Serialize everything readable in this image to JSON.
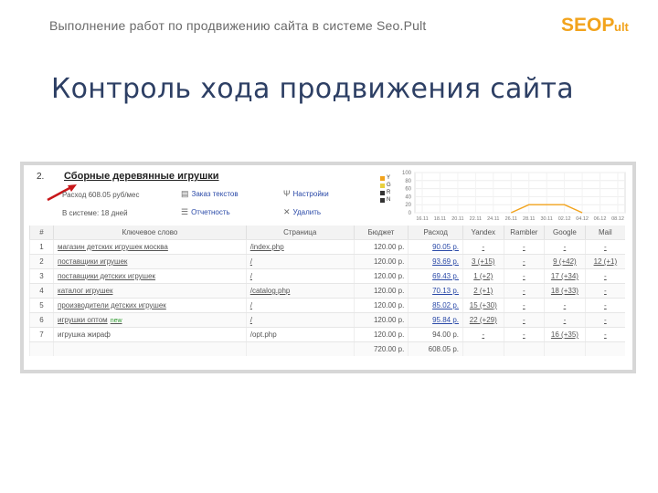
{
  "header": {
    "title": "Выполнение работ по продвижению сайта в системе Seo.Pult",
    "logo_main": "SEOP",
    "logo_small": "ult"
  },
  "slide_title": "Контроль хода продвижения сайта",
  "project": {
    "number": "2.",
    "name": "Сборные деревянные игрушки",
    "expense": "Расход 608.05 руб/мес",
    "in_system": "В системе: 18 дней",
    "actions": [
      {
        "label": "Заказ текстов",
        "icon": "document-icon"
      },
      {
        "label": "Настройки",
        "icon": "settings-icon"
      },
      {
        "label": "Отчетность",
        "icon": "report-icon"
      },
      {
        "label": "Удалить",
        "icon": "close-icon"
      }
    ]
  },
  "chart_data": {
    "type": "line",
    "y_ticks": [
      "100",
      "80",
      "60",
      "40",
      "20",
      "0"
    ],
    "x_ticks": [
      "16.11",
      "18.11",
      "20.11",
      "22.11",
      "24.11",
      "26.11",
      "28.11",
      "30.11",
      "02.12",
      "04.12",
      "06.12",
      "08.12"
    ],
    "legend": [
      {
        "label": "Y",
        "color": "#f2a31c"
      },
      {
        "label": "G",
        "color": "#e8d040"
      },
      {
        "label": "R",
        "color": "#333333"
      },
      {
        "label": "N",
        "color": "#333333"
      }
    ],
    "series": [
      {
        "color": "#f2a31c",
        "values": [
          null,
          null,
          null,
          null,
          null,
          0,
          20,
          20,
          20,
          0,
          null,
          null
        ]
      }
    ],
    "ylim": [
      0,
      100
    ],
    "grid": true
  },
  "table": {
    "headers": [
      "#",
      "Ключевое слово",
      "Страница",
      "Бюджет",
      "Расход",
      "Yandex",
      "Rambler",
      "Google",
      "Mail"
    ],
    "rows": [
      {
        "n": "1",
        "kw": "магазин детских игрушек москва",
        "page": "/index.php",
        "budget": "120.00 р.",
        "spend": "90.05 р.",
        "y": "-",
        "r": "-",
        "g": "-",
        "m": "-"
      },
      {
        "n": "2",
        "kw": "поставщики игрушек",
        "page": "/",
        "budget": "120.00 р.",
        "spend": "93.69 р.",
        "y": "3 (+15)",
        "r": "-",
        "g": "9 (+42)",
        "m": "12 (+1)"
      },
      {
        "n": "3",
        "kw": "поставщики детских игрушек",
        "page": "/",
        "budget": "120.00 р.",
        "spend": "69.43 р.",
        "y": "1 (+2)",
        "r": "-",
        "g": "17 (+34)",
        "m": "-"
      },
      {
        "n": "4",
        "kw": "каталог игрушек",
        "page": "/catalog.php",
        "budget": "120.00 р.",
        "spend": "70.13 р.",
        "y": "2 (+1)",
        "r": "-",
        "g": "18 (+33)",
        "m": "-"
      },
      {
        "n": "5",
        "kw": "производители детских игрушек",
        "page": "/",
        "budget": "120.00 р.",
        "spend": "85.02 р.",
        "y": "15 (+30)",
        "r": "-",
        "g": "-",
        "m": "-"
      },
      {
        "n": "6",
        "kw": "игрушки оптом",
        "tag": "new",
        "page": "/",
        "budget": "120.00 р.",
        "spend": "95.84 р.",
        "y": "22 (+29)",
        "r": "-",
        "g": "-",
        "m": "-"
      },
      {
        "n": "7",
        "kw": "игрушка жираф",
        "page": "/opt.php",
        "budget": "120.00 р.",
        "spend": "94.00 р.",
        "y": "-",
        "r": "-",
        "g": "16 (+35)",
        "m": "-"
      }
    ],
    "totals": {
      "budget": "720.00 р.",
      "spend": "608.05 р."
    }
  }
}
